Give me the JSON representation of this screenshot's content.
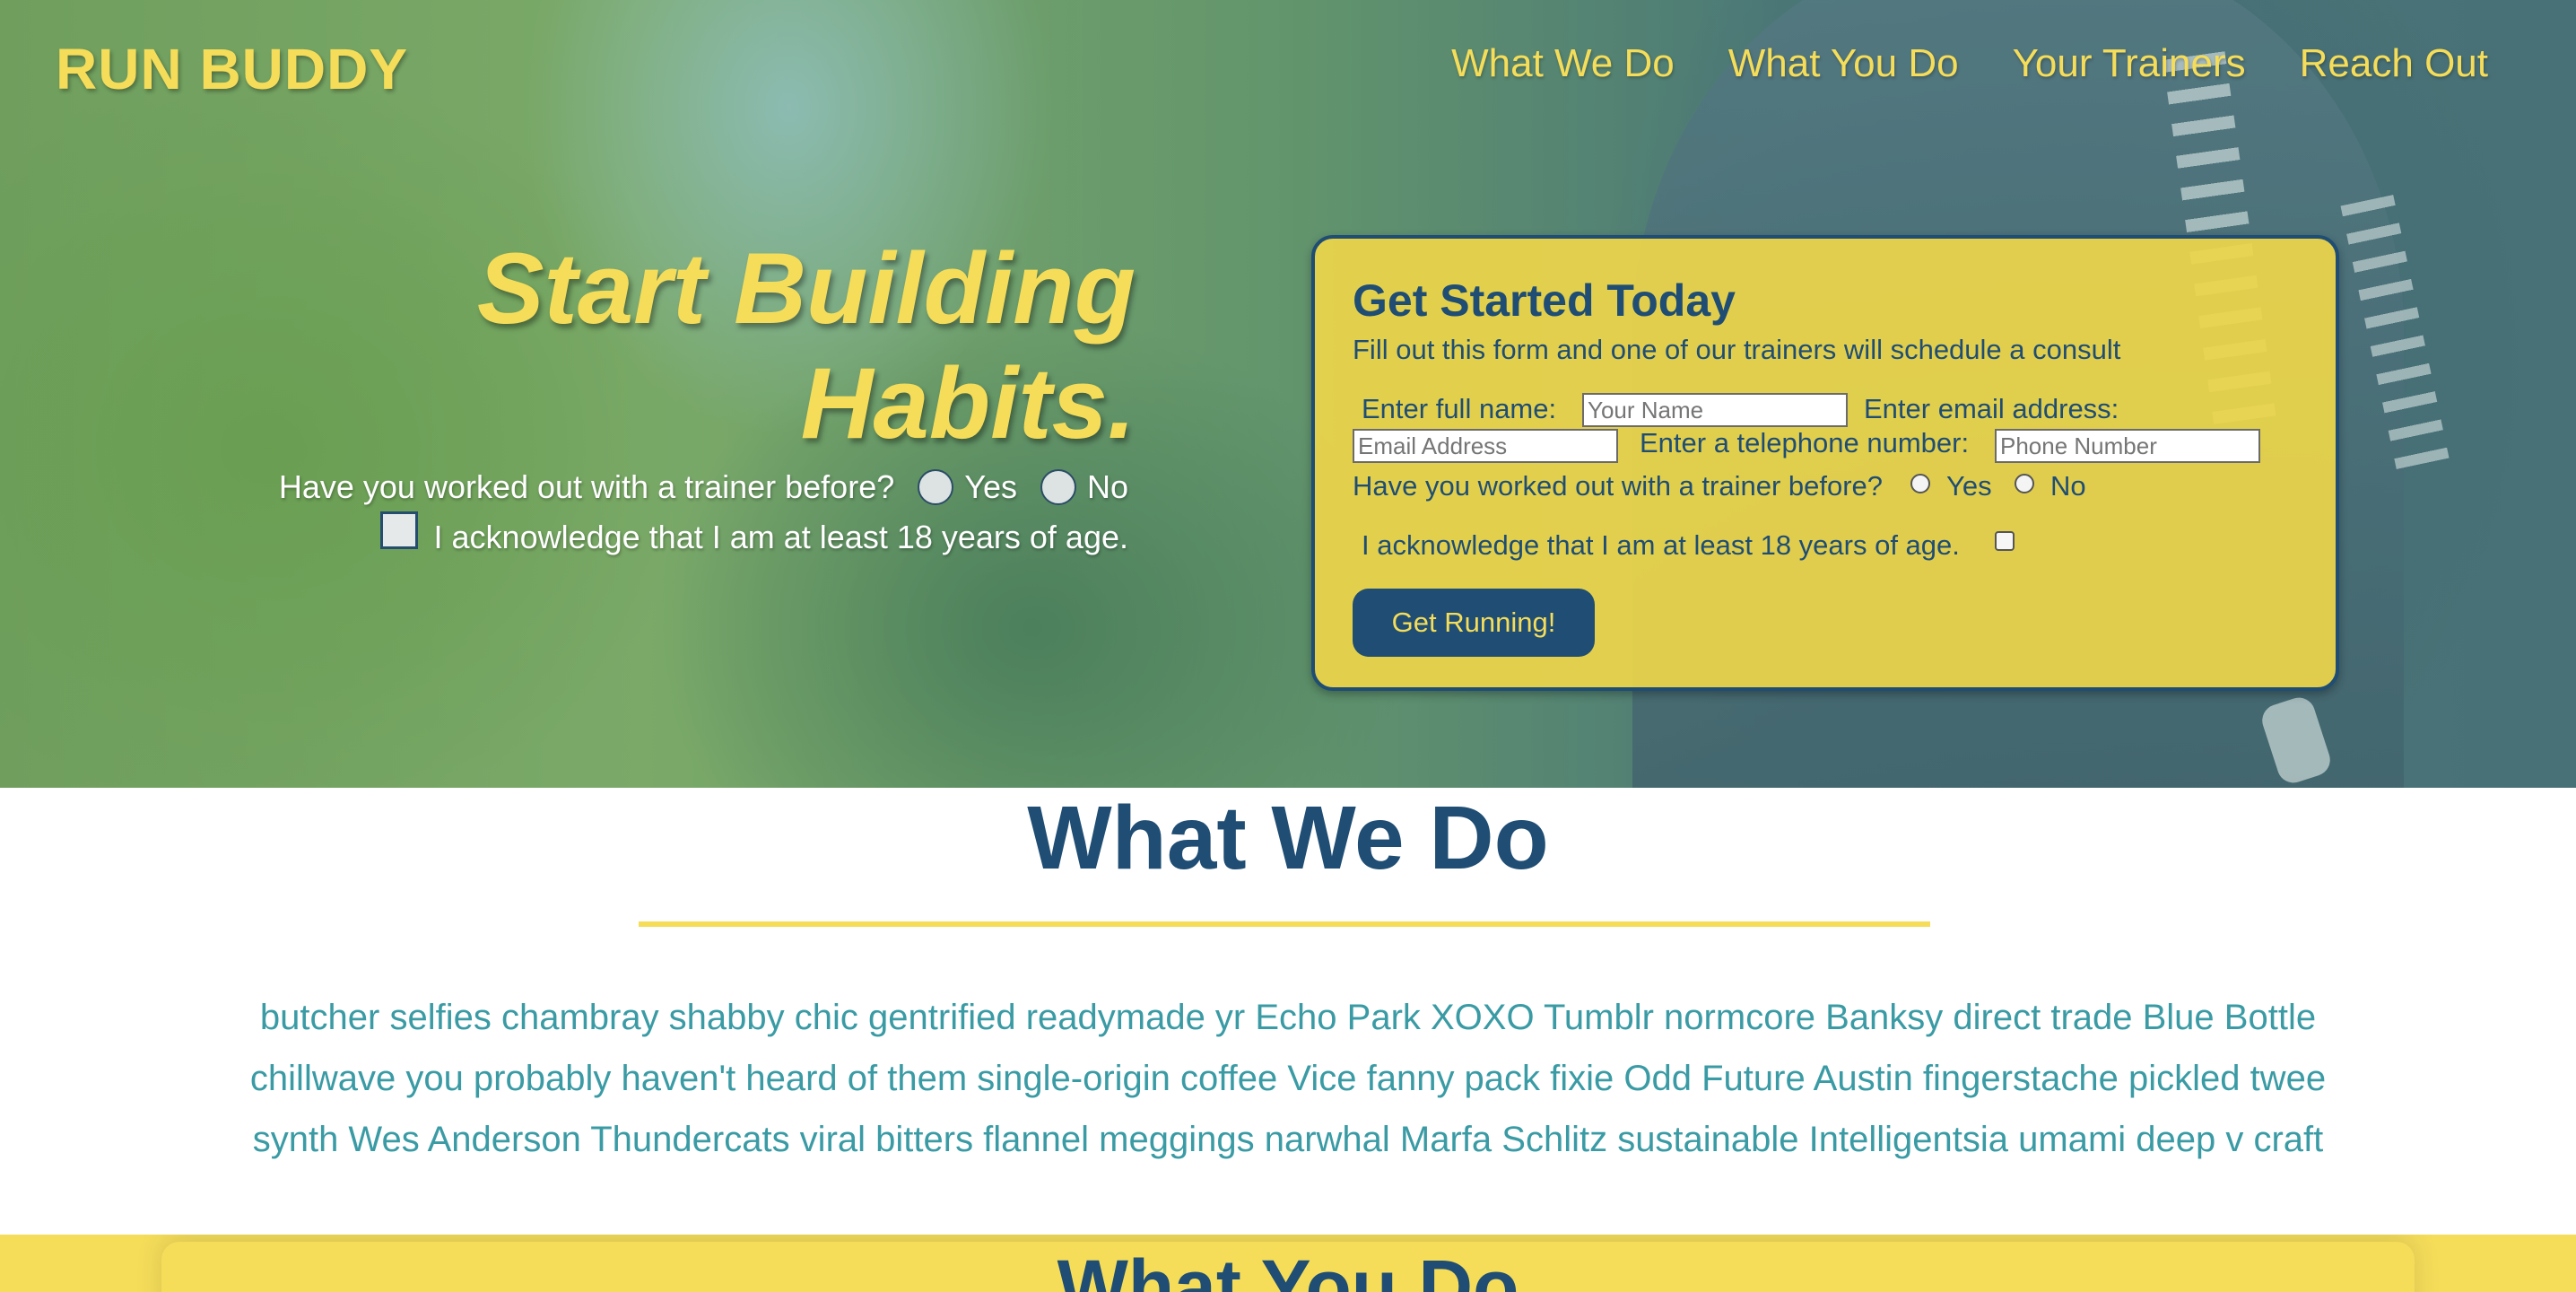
{
  "header": {
    "logo": "RUN BUDDY",
    "nav": [
      "What We Do",
      "What You Do",
      "Your Trainers",
      "Reach Out"
    ]
  },
  "hero": {
    "title_line1": "Start Building",
    "title_line2": "Habits.",
    "question": "Have you worked out with a trainer before?",
    "yes_label": "Yes",
    "no_label": "No",
    "acknowledge": "I acknowledge that I am at least 18 years of age."
  },
  "form": {
    "title": "Get Started Today",
    "subtitle": "Fill out this form and one of our trainers will schedule a consult",
    "name_label": "Enter full name:",
    "name_placeholder": "Your Name",
    "email_label": "Enter email address:",
    "email_placeholder": "Email Address",
    "phone_label": "Enter a telephone number:",
    "phone_placeholder": "Phone Number",
    "question": "Have you worked out with a trainer before?",
    "yes_label": "Yes",
    "no_label": "No",
    "acknowledge": "I acknowledge that I am at least 18 years of age.",
    "submit_label": "Get Running!"
  },
  "what_we_do": {
    "title": "What We Do",
    "body": "butcher selfies chambray shabby chic gentrified readymade yr Echo Park XOXO Tumblr normcore Banksy direct trade Blue Bottle chillwave you probably haven't heard of them single-origin coffee Vice fanny pack fixie Odd Future Austin fingerstache pickled twee synth Wes Anderson Thundercats viral bitters flannel meggings narwhal Marfa Schlitz sustainable Intelligentsia umami deep v craft"
  },
  "what_you_do": {
    "title": "What You Do"
  },
  "colors": {
    "brand_yellow": "#f5dd5a",
    "brand_navy": "#1f4d73",
    "body_teal": "#3a9ba5"
  }
}
